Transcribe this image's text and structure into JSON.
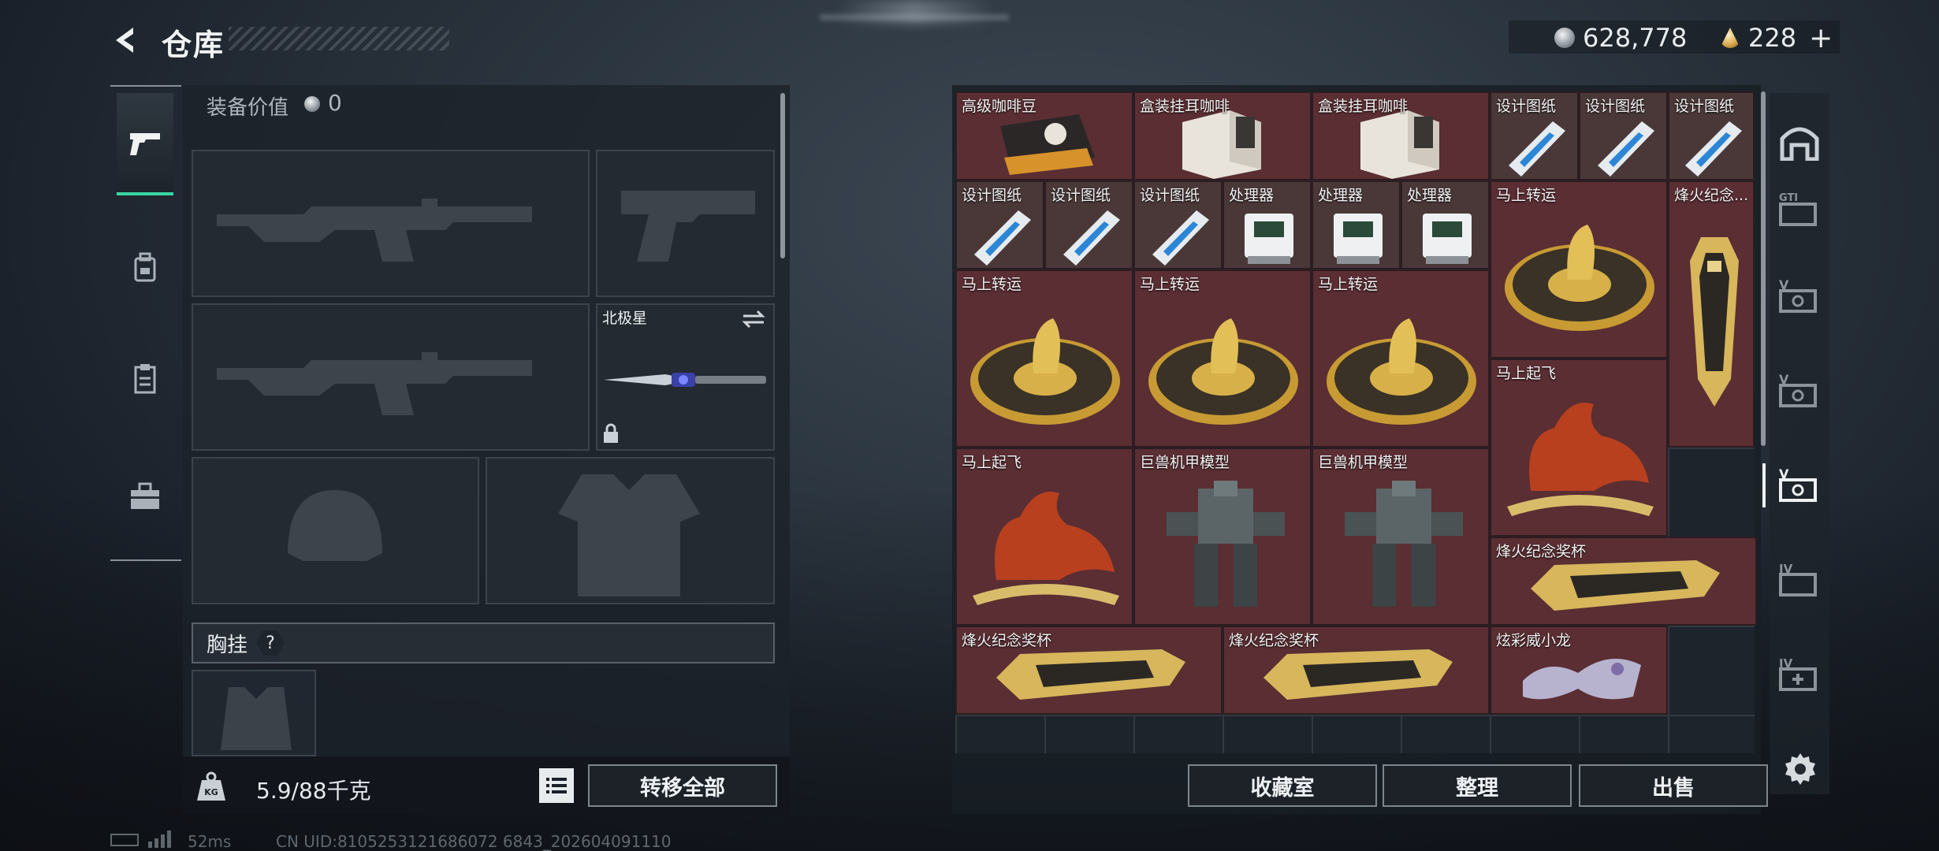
{
  "header": {
    "title": "仓库"
  },
  "currency": {
    "silver": "628,778",
    "gold": "228"
  },
  "loadout": {
    "value_label": "装备价值",
    "value": "0",
    "melee_name": "北极星",
    "chest_label": "胸挂",
    "help": "?",
    "weight": "5.9/88千克",
    "transfer_all": "转移全部"
  },
  "storage": {
    "items": [
      {
        "name": "高级咖啡豆",
        "icon": "coffee-bean-bag-icon"
      },
      {
        "name": "盒装挂耳咖啡",
        "icon": "coffee-box-icon"
      },
      {
        "name": "盒装挂耳咖啡",
        "icon": "coffee-box-icon"
      },
      {
        "name": "设计图纸",
        "icon": "blueprint-icon"
      },
      {
        "name": "设计图纸",
        "icon": "blueprint-icon"
      },
      {
        "name": "设计图纸",
        "icon": "blueprint-icon"
      },
      {
        "name": "设计图纸",
        "icon": "blueprint-icon"
      },
      {
        "name": "设计图纸",
        "icon": "blueprint-icon"
      },
      {
        "name": "设计图纸",
        "icon": "blueprint-icon"
      },
      {
        "name": "处理器",
        "icon": "processor-icon"
      },
      {
        "name": "处理器",
        "icon": "processor-icon"
      },
      {
        "name": "处理器",
        "icon": "processor-icon"
      },
      {
        "name": "马上转运",
        "icon": "horse-fortune-disc-icon"
      },
      {
        "name": "烽火纪念...",
        "icon": "trophy-icon"
      },
      {
        "name": "马上转运",
        "icon": "horse-fortune-disc-icon"
      },
      {
        "name": "马上转运",
        "icon": "horse-fortune-disc-icon"
      },
      {
        "name": "马上转运",
        "icon": "horse-fortune-disc-icon"
      },
      {
        "name": "马上起飞",
        "icon": "red-horse-statue-icon"
      },
      {
        "name": "马上起飞",
        "icon": "red-horse-statue-icon"
      },
      {
        "name": "巨兽机甲模型",
        "icon": "mech-model-icon"
      },
      {
        "name": "巨兽机甲模型",
        "icon": "mech-model-icon"
      },
      {
        "name": "烽火纪念奖杯",
        "icon": "trophy-icon"
      },
      {
        "name": "烽火纪念奖杯",
        "icon": "trophy-icon"
      },
      {
        "name": "烽火纪念奖杯",
        "icon": "trophy-icon"
      },
      {
        "name": "炫彩威小龙",
        "icon": "dragon-figurine-icon"
      }
    ],
    "buttons": {
      "collection": "收藏室",
      "sort": "整理",
      "sell": "出售"
    }
  },
  "footer": {
    "ping": "52ms",
    "uid": "CN UID:8105253121686072 6843_202604091110"
  },
  "colors": {
    "accent": "#38d6a2",
    "item_bg": "#5a2e33"
  }
}
